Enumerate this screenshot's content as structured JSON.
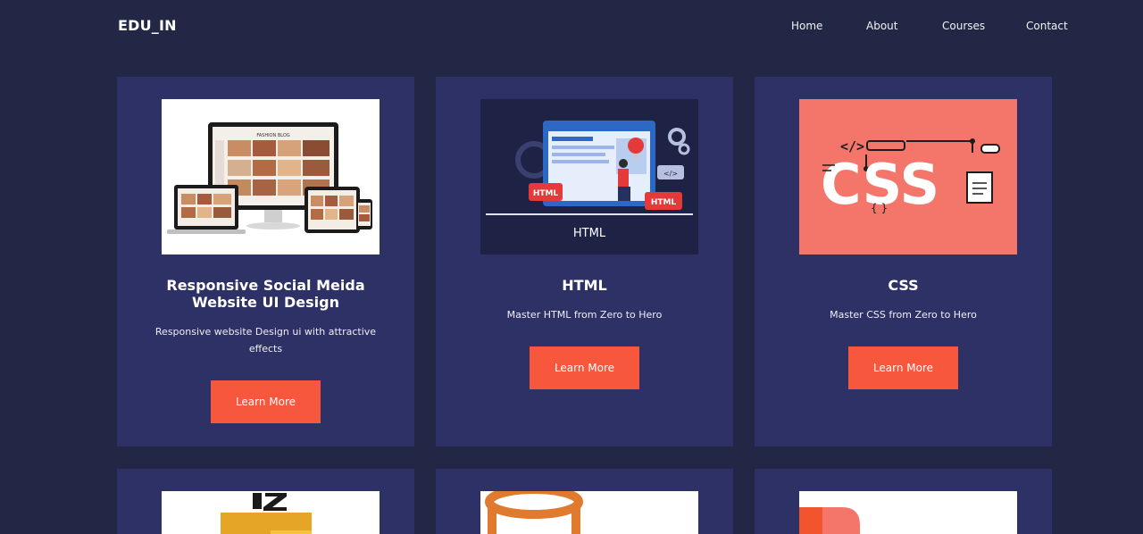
{
  "brand": "EDU_IN",
  "nav": {
    "home": "Home",
    "about": "About",
    "courses": "Courses",
    "contact": "Contact"
  },
  "cards": [
    {
      "title_line1": "Responsive Social Meida",
      "title_line2": "Website UI Design",
      "desc_line1": "Responsive website Design ui with attractive",
      "desc_line2": "effects",
      "button": "Learn More",
      "image_text": "FASHION BLOG"
    },
    {
      "title": "HTML",
      "desc": "Master HTML from Zero to Hero",
      "button": "Learn More",
      "image_caption": "HTML",
      "image_badge": "HTML",
      "image_code": "</>"
    },
    {
      "title": "CSS",
      "desc": "Master CSS from Zero to Hero",
      "button": "Learn More",
      "image_text": "CSS",
      "image_code": "</>"
    }
  ],
  "colors": {
    "background": "#212744",
    "card": "#2e3166",
    "accent": "#f6573d"
  }
}
